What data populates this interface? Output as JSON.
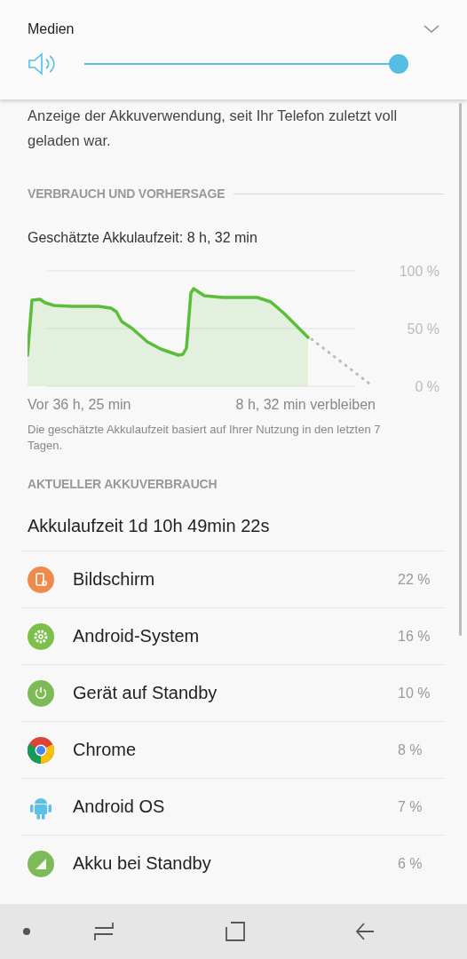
{
  "volume_panel": {
    "title": "Medien",
    "level": 1.0
  },
  "description": "Anzeige der Akkuverwendung, seit Ihr Telefon zuletzt voll geladen war.",
  "sections": [
    {
      "header": "VERBRAUCH UND VORHERSAGE"
    },
    {
      "header": "AKTUELLER AKKUVERBRAUCH"
    }
  ],
  "estimate": "Geschätzte Akkulaufzeit: 8 h, 32 min",
  "chart": {
    "y_labels": [
      "100 %",
      "50 %",
      "0 %"
    ],
    "start_label": "Vor 36 h, 25 min",
    "end_label": "8 h, 32 min verbleiben"
  },
  "chart_note": "Die geschätzte Akkulaufzeit basiert auf Ihrer Nutzung in den letzten 7 Tagen.",
  "battery_time": "Akkulaufzeit 1d 10h 49min 22s",
  "apps": [
    {
      "name": "Bildschirm",
      "percent": "22 %",
      "kind": "screen"
    },
    {
      "name": "Android-System",
      "percent": "16 %",
      "kind": "gear"
    },
    {
      "name": "Gerät auf Standby",
      "percent": "10 %",
      "kind": "power"
    },
    {
      "name": "Chrome",
      "percent": "8 %",
      "kind": "chrome"
    },
    {
      "name": "Android OS",
      "percent": "7 %",
      "kind": "robot"
    },
    {
      "name": "Akku bei Standby",
      "percent": "6 %",
      "kind": "signal"
    }
  ]
}
